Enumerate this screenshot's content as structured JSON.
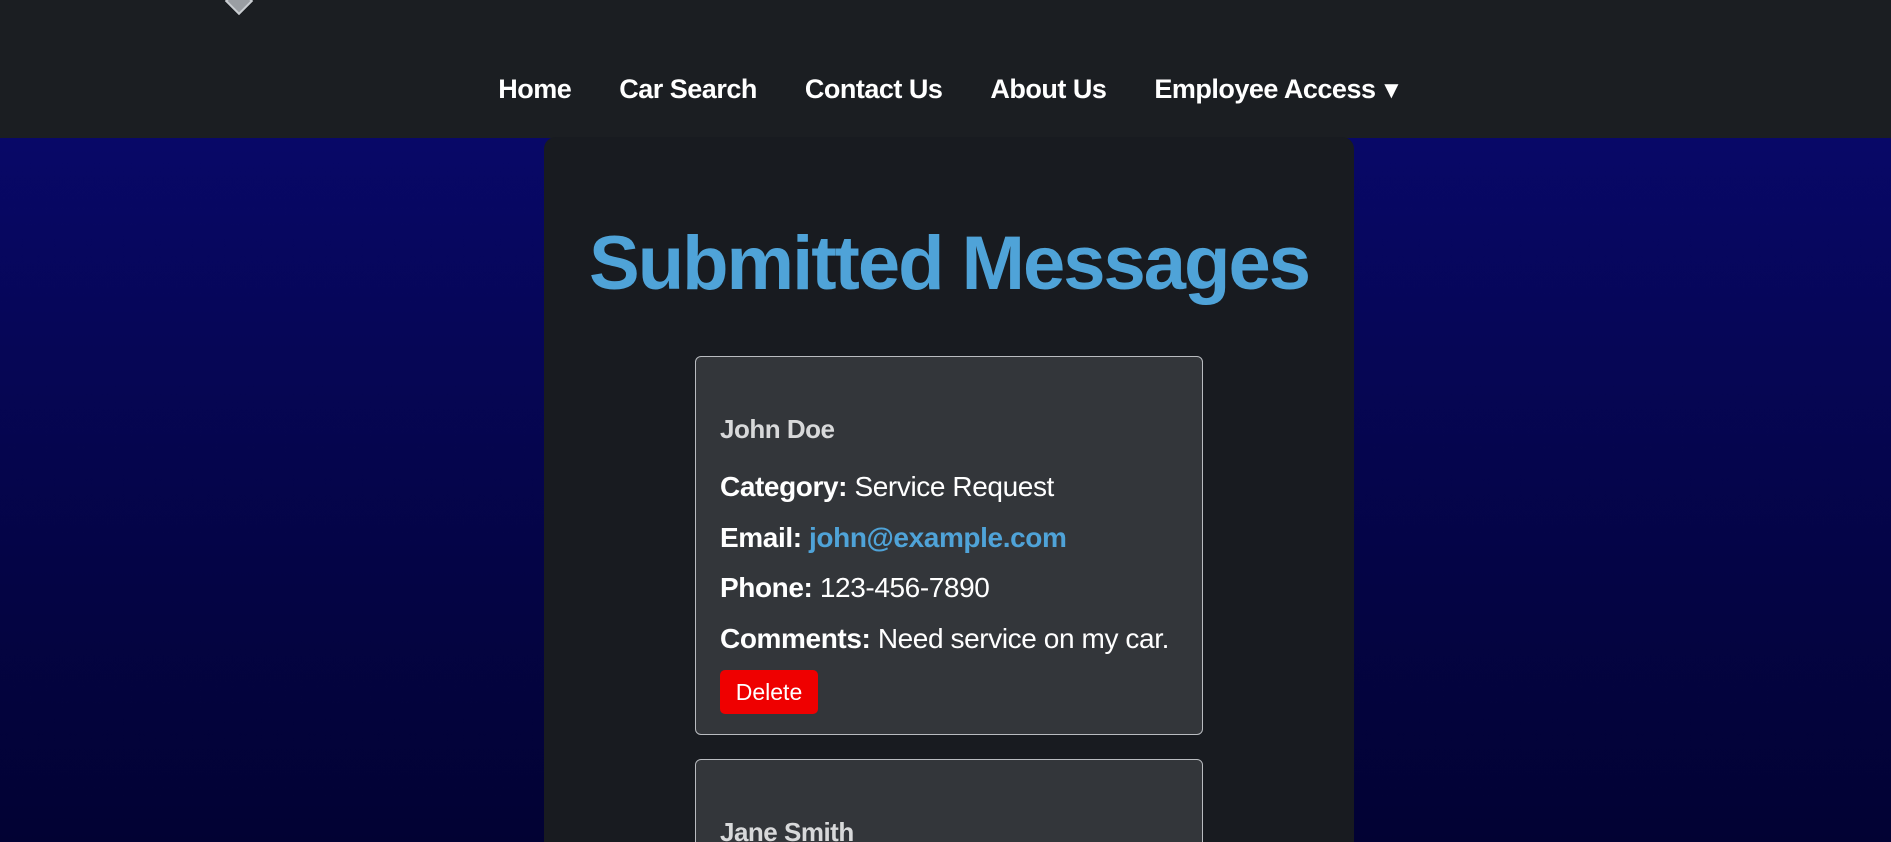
{
  "nav": {
    "items": [
      {
        "label": "Home"
      },
      {
        "label": "Car Search"
      },
      {
        "label": "Contact Us"
      },
      {
        "label": "About Us"
      },
      {
        "label": "Employee Access"
      }
    ],
    "dropdown_caret": "▼"
  },
  "page": {
    "title": "Submitted Messages"
  },
  "labels": {
    "category": "Category:",
    "email": "Email:",
    "phone": "Phone:",
    "comments": "Comments:",
    "delete": "Delete"
  },
  "messages": [
    {
      "name": "John Doe",
      "category": "Service Request",
      "email": "john@example.com",
      "phone": "123-456-7890",
      "comments": "Need service on my car."
    },
    {
      "name": "Jane Smith"
    }
  ],
  "colors": {
    "accent": "#4fa3d8",
    "delete": "#ef0000",
    "header_bg": "#1b1e22",
    "card_bg": "#33363a"
  }
}
